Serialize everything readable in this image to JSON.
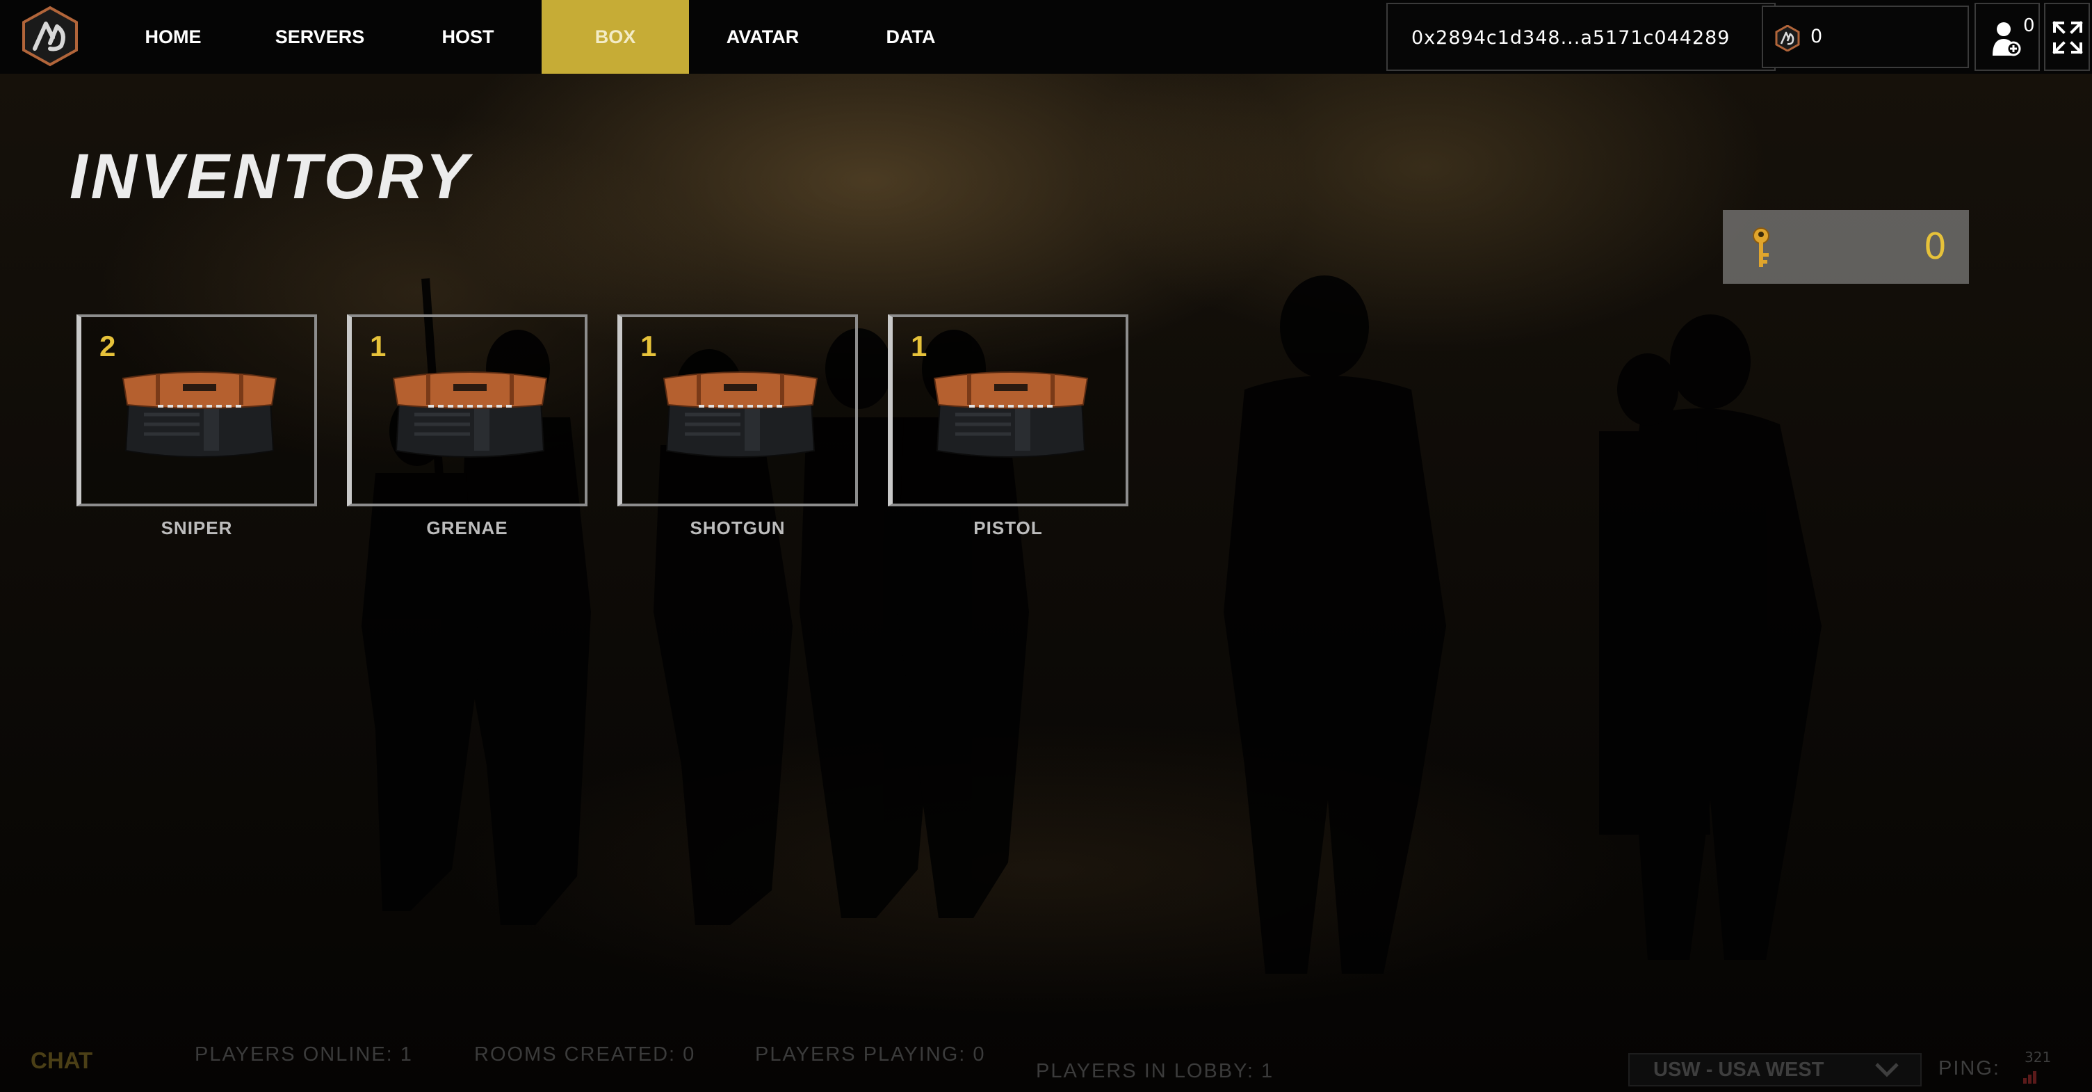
{
  "nav": {
    "items": [
      {
        "label": "HOME"
      },
      {
        "label": "SERVERS"
      },
      {
        "label": "HOST"
      },
      {
        "label": "BOX",
        "active": true
      },
      {
        "label": "AVATAR"
      },
      {
        "label": "DATA"
      }
    ]
  },
  "wallet": {
    "address": "0x2894c1d348...a5171c044289",
    "coin_balance": "0",
    "coin_icon": "ad-coin-icon"
  },
  "user": {
    "count": "0",
    "icon": "add-user-icon"
  },
  "fullscreen": {
    "icon": "fullscreen-icon"
  },
  "page": {
    "title": "INVENTORY"
  },
  "keys": {
    "count": "0",
    "icon": "key-icon"
  },
  "boxes": [
    {
      "name": "SNIPER",
      "quantity": "2"
    },
    {
      "name": "GRENAE",
      "quantity": "1"
    },
    {
      "name": "SHOTGUN",
      "quantity": "1"
    },
    {
      "name": "PISTOL",
      "quantity": "1"
    }
  ],
  "footer": {
    "chat_label": "CHAT",
    "players_online": "PLAYERS ONLINE: 1",
    "rooms_created": "ROOMS CREATED: 0",
    "players_playing": "PLAYERS PLAYING: 0",
    "players_in_lobby": "PLAYERS IN LOBBY: 1",
    "region": "USW - USA WEST",
    "ping_label": "PING:",
    "ping_value": "321"
  },
  "colors": {
    "accent": "#c6ac36",
    "quantity": "#e6c23a",
    "topbar": "#050505"
  }
}
